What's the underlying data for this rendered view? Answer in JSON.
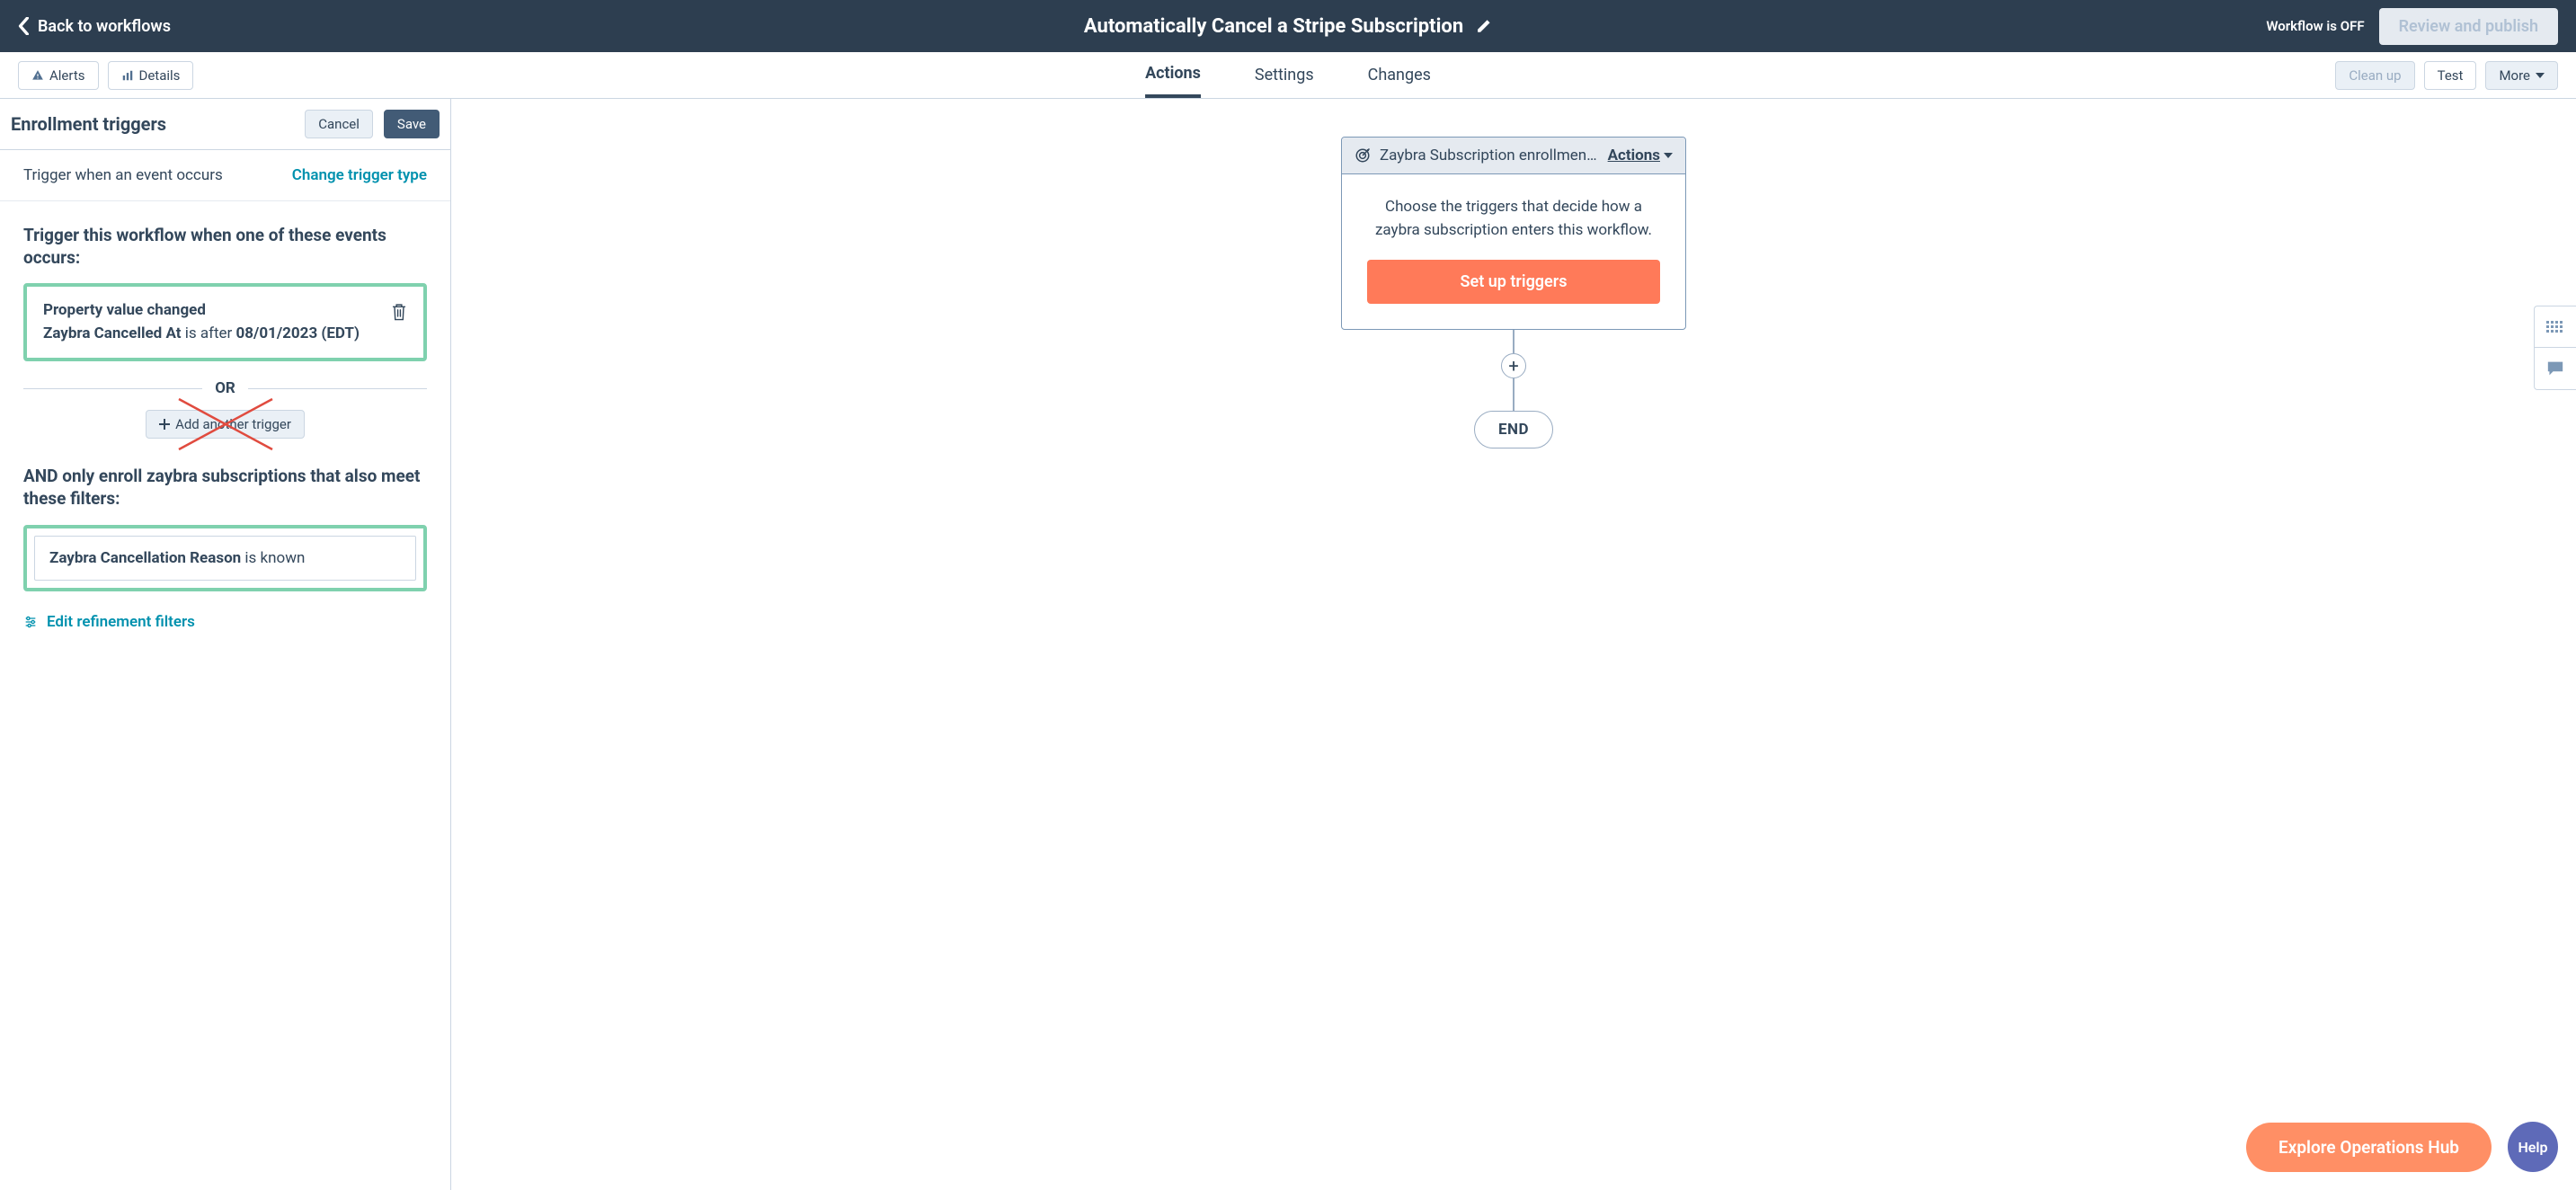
{
  "header": {
    "back_label": "Back to workflows",
    "title": "Automatically Cancel a Stripe Subscription",
    "status": "Workflow is OFF",
    "review_label": "Review and publish"
  },
  "subheader": {
    "alerts_label": "Alerts",
    "details_label": "Details",
    "tabs": {
      "actions": "Actions",
      "settings": "Settings",
      "changes": "Changes"
    },
    "cleanup_label": "Clean up",
    "test_label": "Test",
    "more_label": "More"
  },
  "sidebar": {
    "title": "Enrollment triggers",
    "cancel_label": "Cancel",
    "save_label": "Save",
    "trigger_type_text": "Trigger when an event occurs",
    "change_type_label": "Change trigger type",
    "section1_title": "Trigger this workflow when one of these events occurs:",
    "trigger1": {
      "title": "Property value changed",
      "property": "Zaybra Cancelled At",
      "comparator": "is after",
      "value": "08/01/2023 (EDT)"
    },
    "or_label": "OR",
    "add_another_label": "Add another trigger",
    "section2_title": "AND only enroll zaybra subscriptions that also meet these filters:",
    "filter1": {
      "property": "Zaybra Cancellation Reason",
      "comparator": "is known"
    },
    "edit_filters_label": "Edit refinement filters"
  },
  "canvas": {
    "card_title": "Zaybra Subscription enrollment …",
    "actions_label": "Actions",
    "card_body_text": "Choose the triggers that decide how a zaybra subscription enters this workflow.",
    "setup_btn_label": "Set up triggers",
    "end_label": "END"
  },
  "bottom": {
    "explore_label": "Explore Operations Hub",
    "help_label": "Help"
  }
}
